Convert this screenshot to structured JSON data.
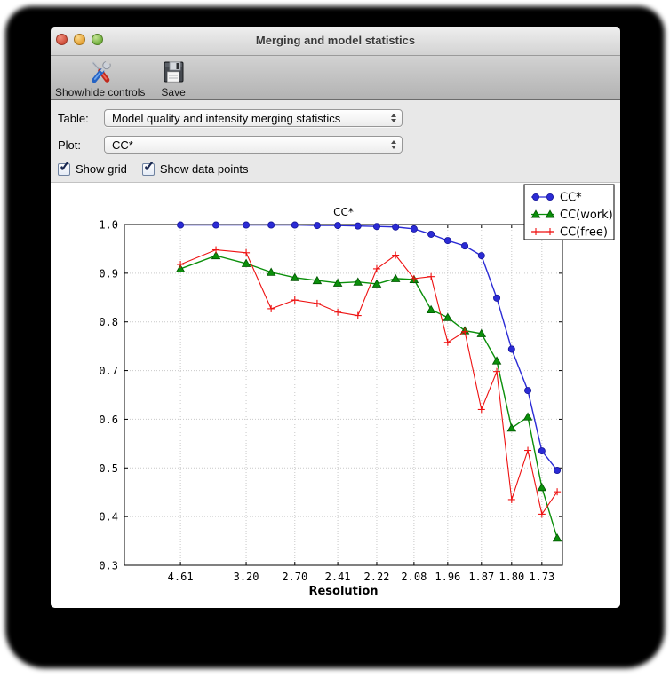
{
  "window": {
    "title": "Merging and model statistics"
  },
  "titlebar": {
    "lights": [
      "close",
      "minimize",
      "zoom"
    ]
  },
  "toolbar": {
    "items": [
      {
        "label": "Show/hide controls",
        "icon": "tools-icon"
      },
      {
        "label": "Save",
        "icon": "save-icon"
      }
    ]
  },
  "controls": {
    "table_label": "Table:",
    "table_value": "Model quality and intensity merging statistics",
    "plot_label": "Plot:",
    "plot_value": "CC*",
    "checkboxes": [
      {
        "label": "Show grid",
        "checked": true
      },
      {
        "label": "Show data points",
        "checked": true
      }
    ]
  },
  "chart_data": {
    "type": "line",
    "title": "CC*",
    "xlabel": "Resolution",
    "ylabel": "",
    "ylim": [
      0.3,
      1.0
    ],
    "grid": true,
    "legend_position": "top-right",
    "y_tick_labels": [
      "1.0",
      "0.9",
      "0.8",
      "0.7",
      "0.6",
      "0.5",
      "0.4",
      "0.3"
    ],
    "y_ticks": [
      1.0,
      0.9,
      0.8,
      0.7,
      0.6,
      0.5,
      0.4,
      0.3
    ],
    "x_tick_labels": [
      "4.61",
      "3.20",
      "2.70",
      "2.41",
      "2.22",
      "2.08",
      "1.96",
      "1.87",
      "1.80",
      "1.73"
    ],
    "x_tick_fractions": [
      0.128,
      0.278,
      0.389,
      0.487,
      0.576,
      0.661,
      0.738,
      0.815,
      0.884,
      0.953
    ],
    "point_x_fractions": [
      0.128,
      0.209,
      0.278,
      0.335,
      0.389,
      0.44,
      0.487,
      0.533,
      0.576,
      0.619,
      0.661,
      0.7,
      0.738,
      0.777,
      0.815,
      0.85,
      0.884,
      0.921,
      0.953,
      0.988
    ],
    "series": [
      {
        "name": "CC*",
        "color": "#2b2bd5",
        "edge_color": "#15159a",
        "marker": "circle",
        "values": [
          0.999,
          0.999,
          0.999,
          0.999,
          0.999,
          0.998,
          0.998,
          0.997,
          0.996,
          0.995,
          0.991,
          0.98,
          0.967,
          0.956,
          0.936,
          0.849,
          0.744,
          0.659,
          0.535,
          0.495
        ]
      },
      {
        "name": "CC(work)",
        "color": "#0a8f0a",
        "edge_color": "#005500",
        "marker": "triangle",
        "values": [
          0.909,
          0.936,
          0.92,
          0.902,
          0.891,
          0.885,
          0.88,
          0.882,
          0.878,
          0.889,
          0.887,
          0.825,
          0.809,
          0.782,
          0.776,
          0.72,
          0.582,
          0.605,
          0.46,
          0.356
        ]
      },
      {
        "name": "CC(free)",
        "color": "#ee1111",
        "edge_color": "#ee1111",
        "marker": "plus",
        "values": [
          0.918,
          0.948,
          0.942,
          0.827,
          0.845,
          0.838,
          0.82,
          0.813,
          0.909,
          0.937,
          0.889,
          0.893,
          0.758,
          0.78,
          0.62,
          0.698,
          0.435,
          0.536,
          0.405,
          0.451
        ]
      }
    ]
  }
}
